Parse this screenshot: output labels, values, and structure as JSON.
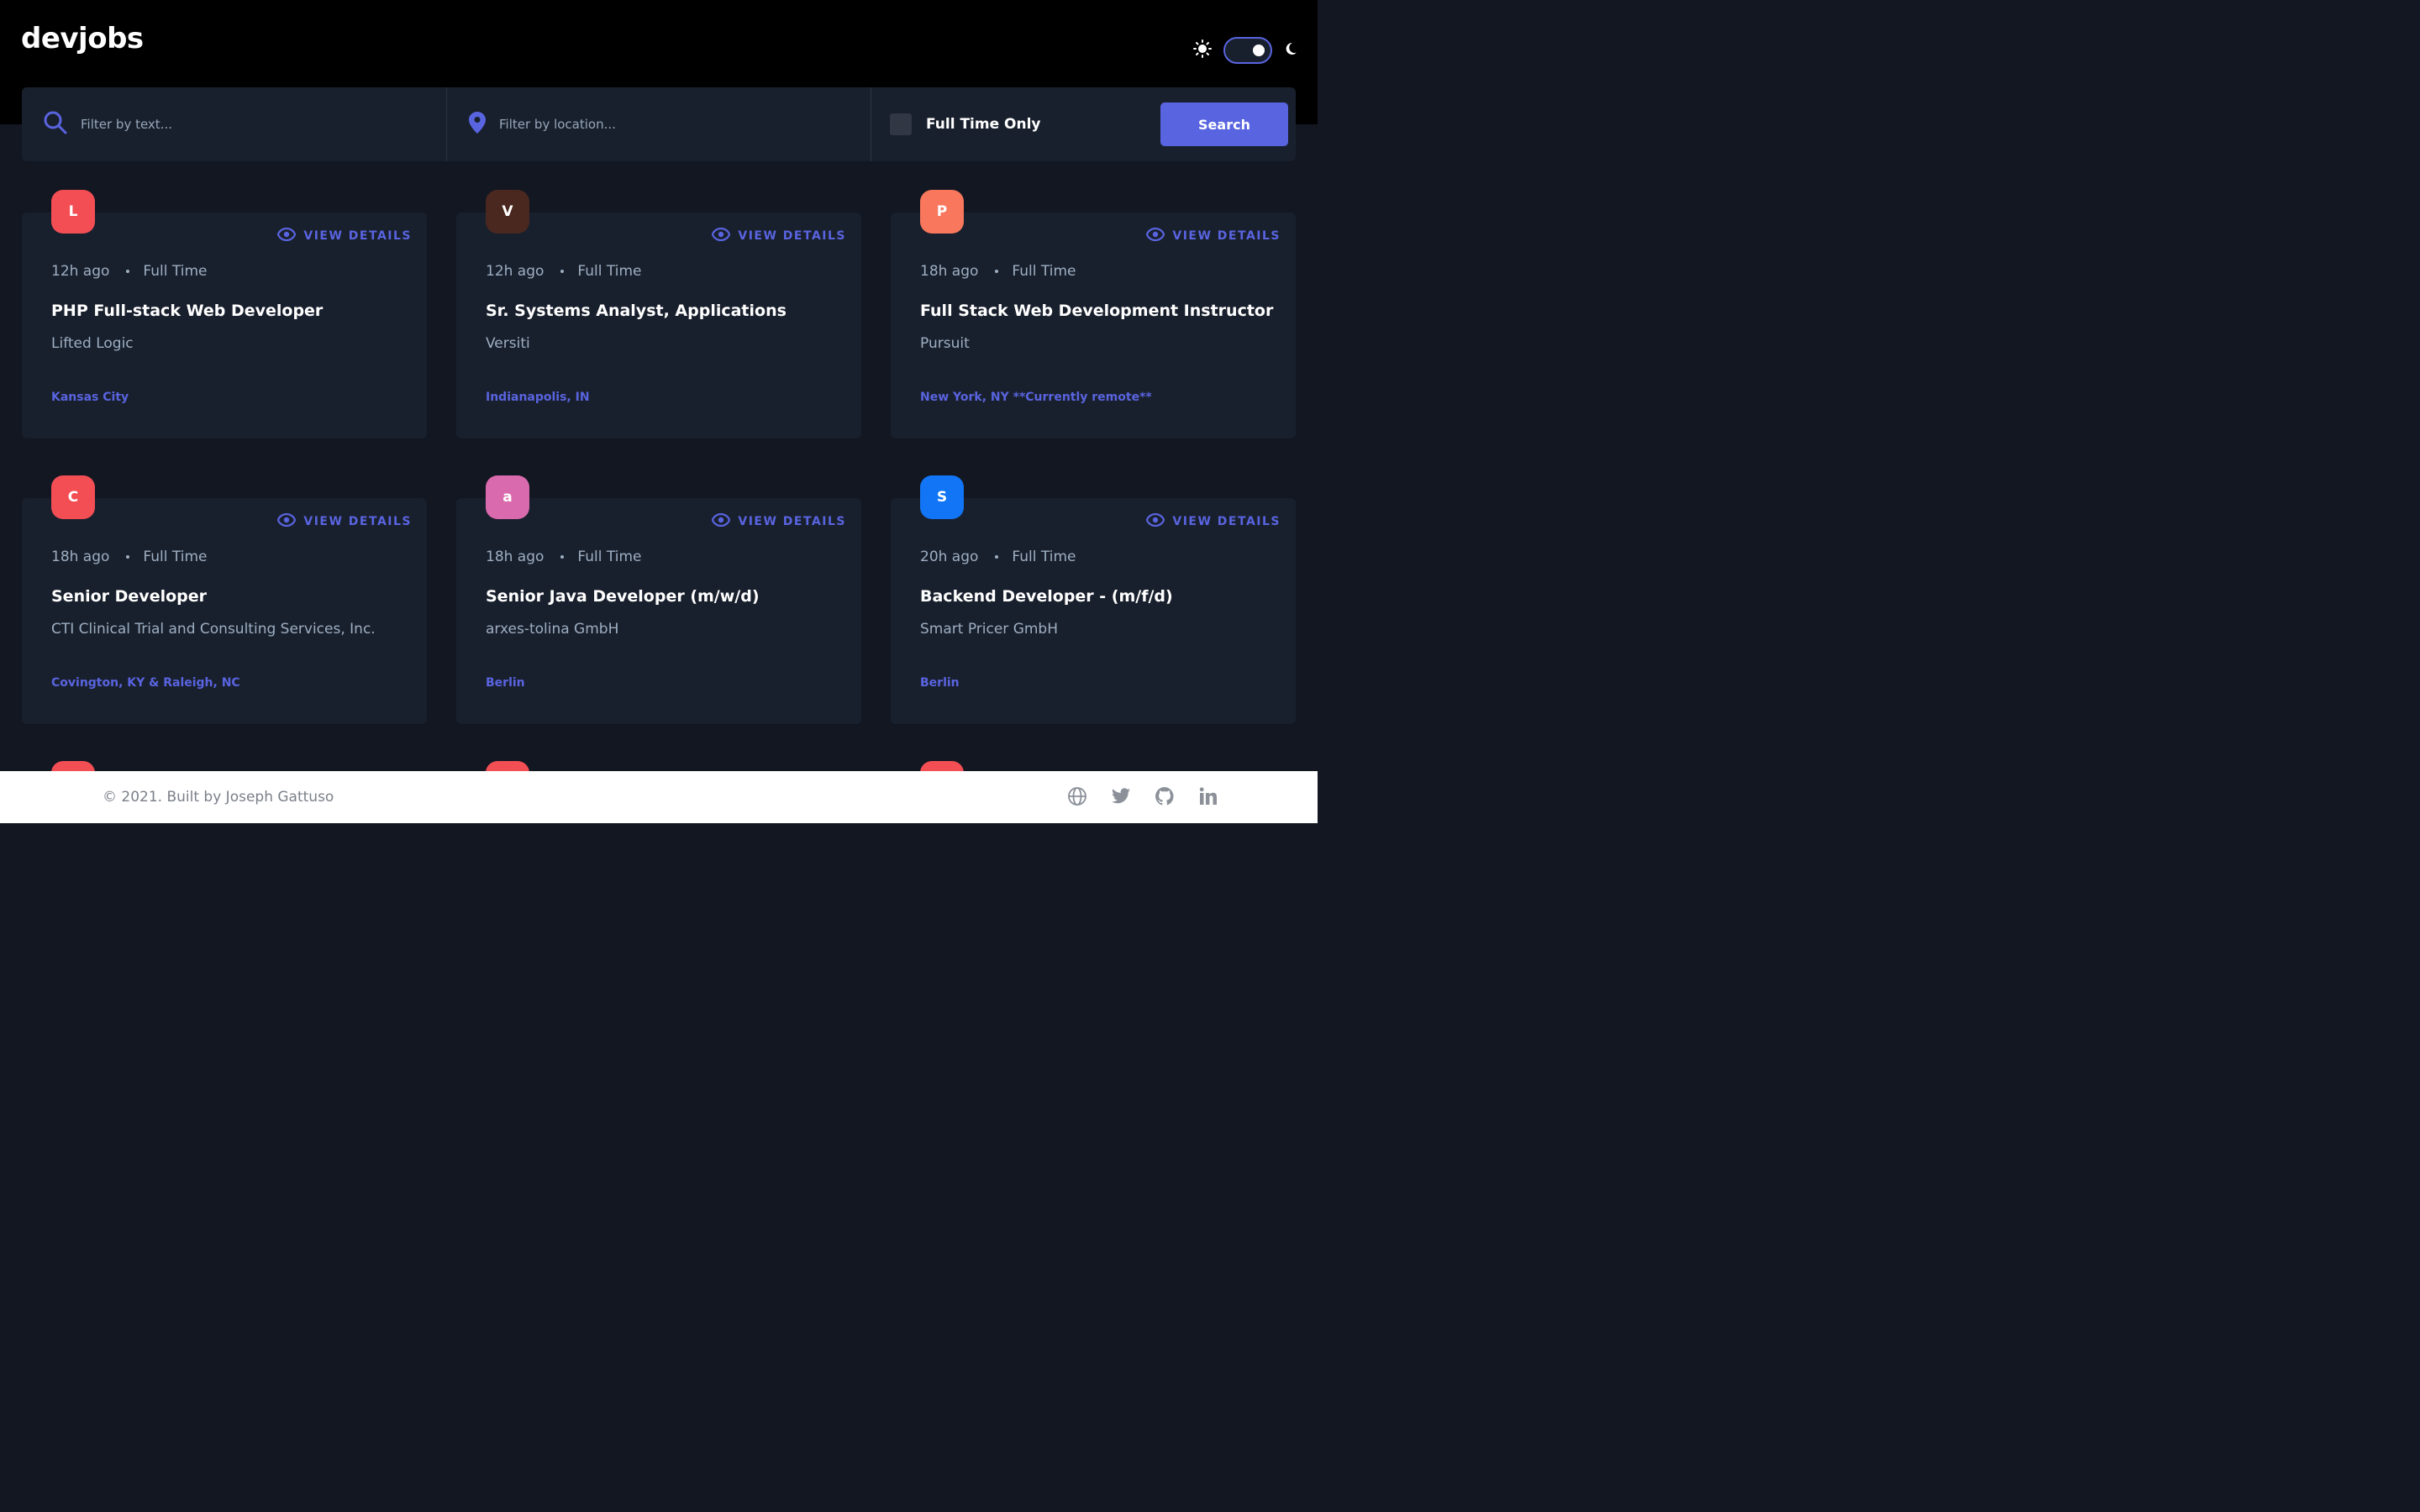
{
  "header": {
    "logo": "devjobs",
    "icons": {
      "light": "sun-icon",
      "dark": "moon-icon"
    },
    "theme_toggle_state": "dark"
  },
  "filters": {
    "text_placeholder": "Filter by text...",
    "location_placeholder": "Filter by location...",
    "full_time_label": "Full Time Only",
    "search_label": "Search",
    "icons": {
      "search": "search-icon",
      "location": "location-pin-icon"
    }
  },
  "colors": {
    "accent": "#5964e0",
    "card": "#19202d",
    "bg": "#121721"
  },
  "view_details_label": "VIEW DETAILS",
  "jobs": [
    {
      "initial": "L",
      "color": "#f44e55",
      "posted": "12h ago",
      "type": "Full Time",
      "title": "PHP Full-stack Web Developer",
      "company": "Lifted Logic",
      "location": "Kansas City"
    },
    {
      "initial": "V",
      "color": "#4a2820",
      "posted": "12h ago",
      "type": "Full Time",
      "title": "Sr. Systems Analyst, Applications",
      "company": "Versiti",
      "location": "Indianapolis, IN"
    },
    {
      "initial": "P",
      "color": "#f9775d",
      "posted": "18h ago",
      "type": "Full Time",
      "title": "Full Stack Web Development Instructor",
      "company": "Pursuit",
      "location": "New York, NY **Currently remote**"
    },
    {
      "initial": "C",
      "color": "#f44e55",
      "posted": "18h ago",
      "type": "Full Time",
      "title": "Senior Developer",
      "company": "CTI Clinical Trial and Consulting Services, Inc.",
      "location": "Covington, KY & Raleigh, NC"
    },
    {
      "initial": "a",
      "color": "#d96aad",
      "posted": "18h ago",
      "type": "Full Time",
      "title": "Senior Java Developer (m/w/d)",
      "company": "arxes-tolina GmbH",
      "location": "Berlin"
    },
    {
      "initial": "S",
      "color": "#1275f5",
      "posted": "20h ago",
      "type": "Full Time",
      "title": "Backend Developer - (m/f/d)",
      "company": "Smart Pricer GmbH",
      "location": "Berlin"
    }
  ],
  "footer": {
    "copyright": "© 2021. Built by Joseph Gattuso",
    "icons": [
      "globe-icon",
      "twitter-icon",
      "github-icon",
      "linkedin-icon"
    ]
  }
}
